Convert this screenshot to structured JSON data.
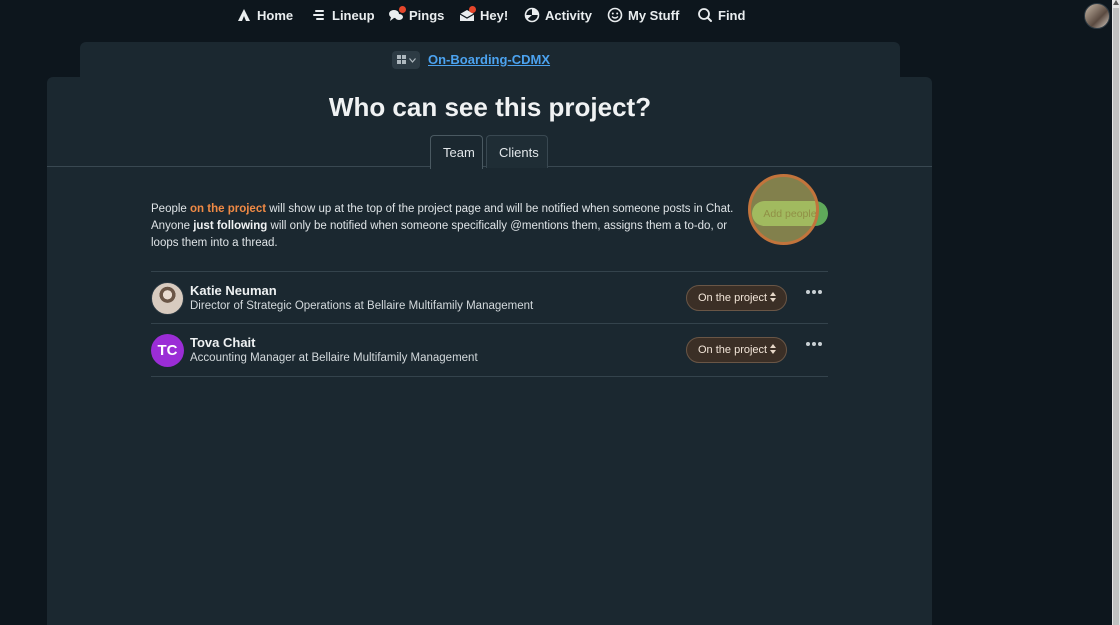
{
  "nav": {
    "items": [
      {
        "label": "Home",
        "icon": "home-icon"
      },
      {
        "label": "Lineup",
        "icon": "lineup-icon"
      },
      {
        "label": "Pings",
        "icon": "pings-icon"
      },
      {
        "label": "Hey!",
        "icon": "hey-icon"
      },
      {
        "label": "Activity",
        "icon": "activity-icon"
      },
      {
        "label": "My Stuff",
        "icon": "smiley-icon"
      },
      {
        "label": "Find",
        "icon": "search-icon"
      }
    ]
  },
  "project": {
    "name": "On-Boarding-CDMX"
  },
  "page": {
    "title": "Who can see this project?",
    "tabs": [
      {
        "label": "Team"
      },
      {
        "label": "Clients"
      }
    ]
  },
  "description": {
    "p1_a": "People ",
    "p1_hl": "on the project",
    "p1_b": " will show up at the top of the project page and will be notified when someone posts in Chat. Anyone ",
    "p1_bold": "just following",
    "p1_c": " will only be notified when someone specifically @mentions them, assigns them a to-do, or loops them into a thread."
  },
  "add_people_label": "Add people",
  "people": [
    {
      "name": "Katie Neuman",
      "role": "Director of Strategic Operations at Bellaire Multifamily Management",
      "status": "On the project"
    },
    {
      "name": "Tova Chait",
      "initials": "TC",
      "role": "Accounting Manager at Bellaire Multifamily Management",
      "status": "On the project"
    }
  ],
  "colors": {
    "accent_link": "#4ca3f0",
    "highlight_text": "#f08a45",
    "add_button": "#5fa95a",
    "avatar_tc": "#9b2dd6",
    "notification_dot": "#e5462b"
  }
}
